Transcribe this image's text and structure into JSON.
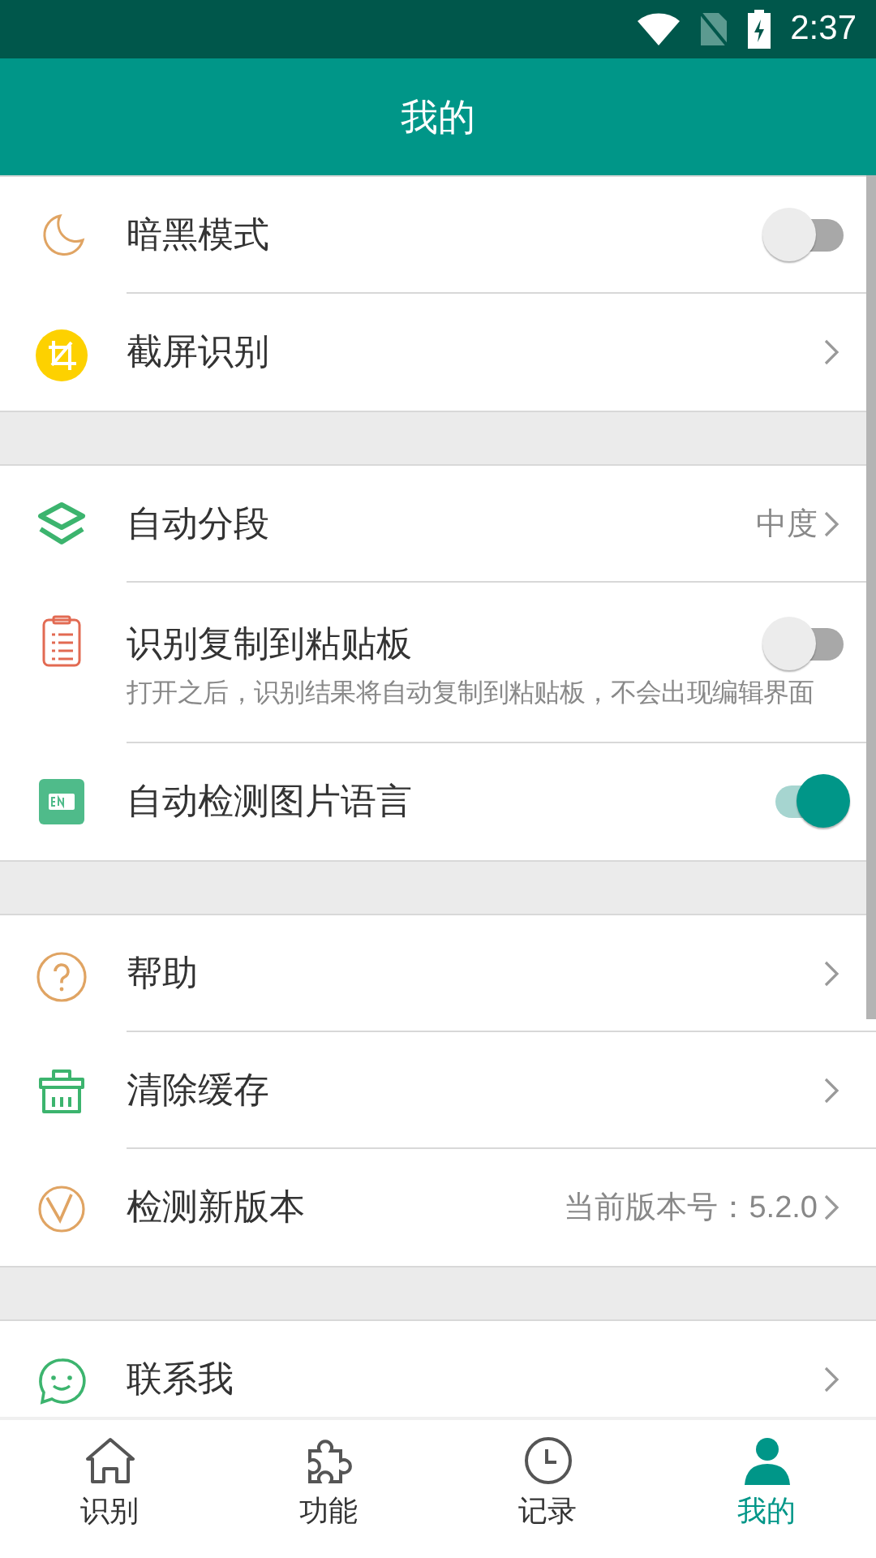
{
  "status_bar": {
    "time": "2:37"
  },
  "header": {
    "title": "我的"
  },
  "sections": [
    {
      "items": [
        {
          "kind": "toggle",
          "label": "暗黑模式",
          "on": false
        },
        {
          "kind": "link",
          "label": "截屏识别"
        }
      ]
    },
    {
      "items": [
        {
          "kind": "link",
          "label": "自动分段",
          "value": "中度"
        },
        {
          "kind": "toggle",
          "label": "识别复制到粘贴板",
          "subtitle": "打开之后，识别结果将自动复制到粘贴板，不会出现编辑界面",
          "on": false
        },
        {
          "kind": "toggle",
          "label": "自动检测图片语言",
          "on": true
        }
      ]
    },
    {
      "items": [
        {
          "kind": "link",
          "label": "帮助"
        },
        {
          "kind": "link",
          "label": "清除缓存"
        },
        {
          "kind": "link",
          "label": "检测新版本",
          "value": "当前版本号：5.2.0"
        }
      ]
    },
    {
      "items": [
        {
          "kind": "link",
          "label": "联系我"
        }
      ]
    }
  ],
  "bottom_nav": [
    {
      "label": "识别",
      "selected": false
    },
    {
      "label": "功能",
      "selected": false
    },
    {
      "label": "记录",
      "selected": false
    },
    {
      "label": "我的",
      "selected": true
    }
  ]
}
